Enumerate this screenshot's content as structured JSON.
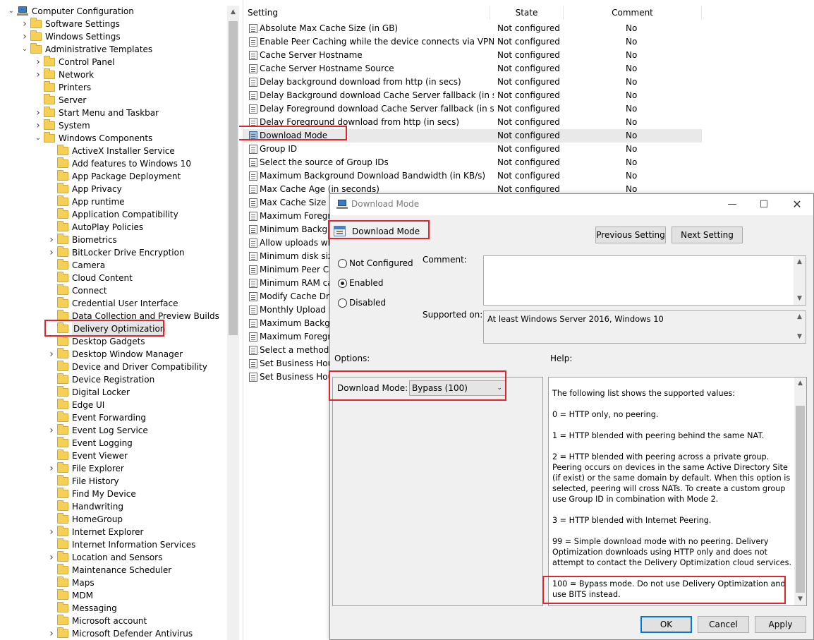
{
  "tree": {
    "items": [
      {
        "label": "Computer Configuration",
        "depth": 0,
        "twisty": "expanded",
        "icon": "computer-icon"
      },
      {
        "label": "Software Settings",
        "depth": 1,
        "twisty": "collapsed"
      },
      {
        "label": "Windows Settings",
        "depth": 1,
        "twisty": "collapsed"
      },
      {
        "label": "Administrative Templates",
        "depth": 1,
        "twisty": "expanded"
      },
      {
        "label": "Control Panel",
        "depth": 2,
        "twisty": "collapsed"
      },
      {
        "label": "Network",
        "depth": 2,
        "twisty": "collapsed"
      },
      {
        "label": "Printers",
        "depth": 2,
        "twisty": "none"
      },
      {
        "label": "Server",
        "depth": 2,
        "twisty": "none"
      },
      {
        "label": "Start Menu and Taskbar",
        "depth": 2,
        "twisty": "collapsed"
      },
      {
        "label": "System",
        "depth": 2,
        "twisty": "collapsed"
      },
      {
        "label": "Windows Components",
        "depth": 2,
        "twisty": "expanded"
      },
      {
        "label": "ActiveX Installer Service",
        "depth": 3,
        "twisty": "none"
      },
      {
        "label": "Add features to Windows 10",
        "depth": 3,
        "twisty": "none"
      },
      {
        "label": "App Package Deployment",
        "depth": 3,
        "twisty": "none"
      },
      {
        "label": "App Privacy",
        "depth": 3,
        "twisty": "none"
      },
      {
        "label": "App runtime",
        "depth": 3,
        "twisty": "none"
      },
      {
        "label": "Application Compatibility",
        "depth": 3,
        "twisty": "none"
      },
      {
        "label": "AutoPlay Policies",
        "depth": 3,
        "twisty": "none"
      },
      {
        "label": "Biometrics",
        "depth": 3,
        "twisty": "collapsed"
      },
      {
        "label": "BitLocker Drive Encryption",
        "depth": 3,
        "twisty": "collapsed"
      },
      {
        "label": "Camera",
        "depth": 3,
        "twisty": "none"
      },
      {
        "label": "Cloud Content",
        "depth": 3,
        "twisty": "none"
      },
      {
        "label": "Connect",
        "depth": 3,
        "twisty": "none"
      },
      {
        "label": "Credential User Interface",
        "depth": 3,
        "twisty": "none"
      },
      {
        "label": "Data Collection and Preview Builds",
        "depth": 3,
        "twisty": "none"
      },
      {
        "label": "Delivery Optimization",
        "depth": 3,
        "twisty": "none",
        "selected": true
      },
      {
        "label": "Desktop Gadgets",
        "depth": 3,
        "twisty": "none"
      },
      {
        "label": "Desktop Window Manager",
        "depth": 3,
        "twisty": "collapsed"
      },
      {
        "label": "Device and Driver Compatibility",
        "depth": 3,
        "twisty": "none"
      },
      {
        "label": "Device Registration",
        "depth": 3,
        "twisty": "none"
      },
      {
        "label": "Digital Locker",
        "depth": 3,
        "twisty": "none"
      },
      {
        "label": "Edge UI",
        "depth": 3,
        "twisty": "none"
      },
      {
        "label": "Event Forwarding",
        "depth": 3,
        "twisty": "none"
      },
      {
        "label": "Event Log Service",
        "depth": 3,
        "twisty": "collapsed"
      },
      {
        "label": "Event Logging",
        "depth": 3,
        "twisty": "none"
      },
      {
        "label": "Event Viewer",
        "depth": 3,
        "twisty": "none"
      },
      {
        "label": "File Explorer",
        "depth": 3,
        "twisty": "collapsed"
      },
      {
        "label": "File History",
        "depth": 3,
        "twisty": "none"
      },
      {
        "label": "Find My Device",
        "depth": 3,
        "twisty": "none"
      },
      {
        "label": "Handwriting",
        "depth": 3,
        "twisty": "none"
      },
      {
        "label": "HomeGroup",
        "depth": 3,
        "twisty": "none"
      },
      {
        "label": "Internet Explorer",
        "depth": 3,
        "twisty": "collapsed"
      },
      {
        "label": "Internet Information Services",
        "depth": 3,
        "twisty": "none"
      },
      {
        "label": "Location and Sensors",
        "depth": 3,
        "twisty": "collapsed"
      },
      {
        "label": "Maintenance Scheduler",
        "depth": 3,
        "twisty": "none"
      },
      {
        "label": "Maps",
        "depth": 3,
        "twisty": "none"
      },
      {
        "label": "MDM",
        "depth": 3,
        "twisty": "none"
      },
      {
        "label": "Messaging",
        "depth": 3,
        "twisty": "none"
      },
      {
        "label": "Microsoft account",
        "depth": 3,
        "twisty": "none"
      },
      {
        "label": "Microsoft Defender Antivirus",
        "depth": 3,
        "twisty": "collapsed"
      }
    ]
  },
  "list": {
    "headers": {
      "setting": "Setting",
      "state": "State",
      "comment": "Comment"
    },
    "rows": [
      {
        "name": "Absolute Max Cache Size (in GB)",
        "state": "Not configured",
        "comment": "No"
      },
      {
        "name": "Enable Peer Caching while the device connects via VPN",
        "state": "Not configured",
        "comment": "No"
      },
      {
        "name": "Cache Server Hostname",
        "state": "Not configured",
        "comment": "No"
      },
      {
        "name": "Cache Server Hostname Source",
        "state": "Not configured",
        "comment": "No"
      },
      {
        "name": "Delay background download from http (in secs)",
        "state": "Not configured",
        "comment": "No"
      },
      {
        "name": "Delay Background download Cache Server fallback (in seco...",
        "state": "Not configured",
        "comment": "No"
      },
      {
        "name": "Delay Foreground download Cache Server fallback (in secon...",
        "state": "Not configured",
        "comment": "No"
      },
      {
        "name": "Delay Foreground download from http (in secs)",
        "state": "Not configured",
        "comment": "No"
      },
      {
        "name": "Download Mode",
        "state": "Not configured",
        "comment": "No",
        "selected": true
      },
      {
        "name": "Group ID",
        "state": "Not configured",
        "comment": "No"
      },
      {
        "name": "Select the source of Group IDs",
        "state": "Not configured",
        "comment": "No"
      },
      {
        "name": "Maximum Background Download Bandwidth (in KB/s)",
        "state": "Not configured",
        "comment": "No"
      },
      {
        "name": "Max Cache Age (in seconds)",
        "state": "Not configured",
        "comment": "No"
      },
      {
        "name": "Max Cache Size (pe",
        "state": "",
        "comment": ""
      },
      {
        "name": "Maximum Foregro",
        "state": "",
        "comment": ""
      },
      {
        "name": "Minimum Backgro",
        "state": "",
        "comment": ""
      },
      {
        "name": "Allow uploads whi",
        "state": "",
        "comment": ""
      },
      {
        "name": "Minimum disk size",
        "state": "",
        "comment": ""
      },
      {
        "name": "Minimum Peer Cac",
        "state": "",
        "comment": ""
      },
      {
        "name": "Minimum RAM cap",
        "state": "",
        "comment": ""
      },
      {
        "name": "Modify Cache Drive",
        "state": "",
        "comment": ""
      },
      {
        "name": "Monthly Upload Da",
        "state": "",
        "comment": ""
      },
      {
        "name": "Maximum Backgro",
        "state": "",
        "comment": ""
      },
      {
        "name": "Maximum Foregro",
        "state": "",
        "comment": ""
      },
      {
        "name": "Select a method to",
        "state": "",
        "comment": ""
      },
      {
        "name": "Set Business Hours",
        "state": "",
        "comment": ""
      },
      {
        "name": "Set Business Hours",
        "state": "",
        "comment": ""
      }
    ]
  },
  "dialog": {
    "title": "Download Mode",
    "setting_name": "Download Mode",
    "buttons": {
      "previous": "Previous Setting",
      "next": "Next Setting",
      "ok": "OK",
      "cancel": "Cancel",
      "apply": "Apply"
    },
    "radios": {
      "not_configured": "Not Configured",
      "enabled": "Enabled",
      "disabled": "Disabled",
      "selected": "enabled"
    },
    "comment_label": "Comment:",
    "supported_label": "Supported on:",
    "supported_value": "At least Windows Server 2016, Windows 10",
    "options_label": "Options:",
    "help_label": "Help:",
    "download_mode_label": "Download Mode:",
    "download_mode_value": "Bypass (100)",
    "help_paragraphs": [
      "The following list shows the supported values:",
      "0 = HTTP only, no peering.",
      "1 = HTTP blended with peering behind the same NAT.",
      "2 = HTTP blended with peering across a private group. Peering occurs on devices in the same Active Directory Site (if exist) or the same domain by default. When this option is selected, peering will cross NATs. To create a custom group use Group ID in combination with Mode 2.",
      "3 = HTTP blended with Internet Peering.",
      "99 = Simple download mode with no peering. Delivery Optimization downloads using HTTP only and does not attempt to contact the Delivery Optimization cloud services.",
      "100 = Bypass mode. Do not use Delivery Optimization and use BITS instead."
    ]
  },
  "colors": {
    "highlight": "#e0262c",
    "folder": "#f6cf57",
    "selected_row": "#e9e9e9",
    "primary_button_border": "#0078d7"
  }
}
